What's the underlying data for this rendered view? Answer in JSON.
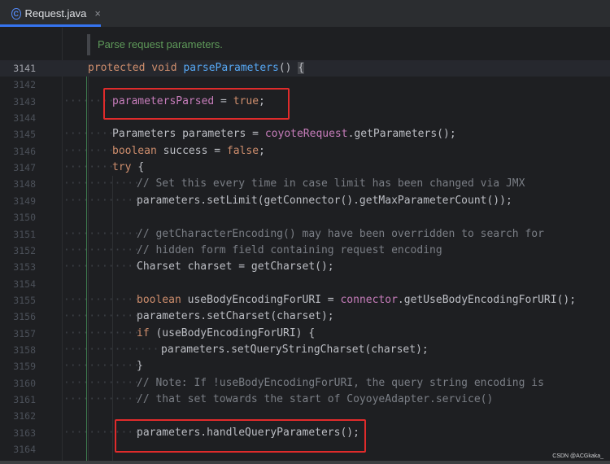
{
  "tab": {
    "icon_letter": "C",
    "label": "Request.java",
    "close": "×"
  },
  "doc_comment": "Parse request parameters.",
  "lines": [
    {
      "num": "3141",
      "html": "<span class=\"kw\">protected void </span><span class=\"fn\">parseParameters</span>() <span class=\"cur-brace\">{</span>"
    },
    {
      "num": "3142",
      "html": ""
    },
    {
      "num": "3143",
      "html": "<span class=\"fld\">parametersParsed</span> = <span class=\"kw\">true</span>;"
    },
    {
      "num": "3144",
      "html": ""
    },
    {
      "num": "3145",
      "html": "Parameters parameters = <span class=\"fld\">coyoteRequest</span>.getParameters();"
    },
    {
      "num": "3146",
      "html": "<span class=\"kw\">boolean </span>success = <span class=\"kw\">false</span>;"
    },
    {
      "num": "3147",
      "html": "<span class=\"kw\">try </span>{"
    },
    {
      "num": "3148",
      "html": "<span class=\"cm\">// Set this every time in case limit has been changed via JMX</span>"
    },
    {
      "num": "3149",
      "html": "parameters.setLimit(getConnector().getMaxParameterCount());"
    },
    {
      "num": "3150",
      "html": ""
    },
    {
      "num": "3151",
      "html": "<span class=\"cm\">// getCharacterEncoding() may have been overridden to search for</span>"
    },
    {
      "num": "3152",
      "html": "<span class=\"cm\">// hidden form field containing request encoding</span>"
    },
    {
      "num": "3153",
      "html": "Charset charset = getCharset();"
    },
    {
      "num": "3154",
      "html": ""
    },
    {
      "num": "3155",
      "html": "<span class=\"kw\">boolean </span>useBodyEncodingForURI = <span class=\"fld\">connector</span>.getUseBodyEncodingForURI();"
    },
    {
      "num": "3156",
      "html": "parameters.setCharset(charset);"
    },
    {
      "num": "3157",
      "html": "<span class=\"kw\">if </span>(useBodyEncodingForURI) {"
    },
    {
      "num": "3158",
      "html": "parameters.setQueryStringCharset(charset);"
    },
    {
      "num": "3159",
      "html": "}"
    },
    {
      "num": "3160",
      "html": "<span class=\"cm\">// Note: If !useBodyEncodingForURI, the query string encoding is</span>"
    },
    {
      "num": "3161",
      "html": "<span class=\"cm\">// that set towards the start of CoyoyeAdapter.service()</span>"
    },
    {
      "num": "3162",
      "html": ""
    },
    {
      "num": "3163",
      "html": "parameters.handleQueryParameters();"
    },
    {
      "num": "3164",
      "html": ""
    }
  ],
  "watermark": "CSDN @ACGkaka_",
  "colors": {
    "keyword": "#cf8e6d",
    "method": "#56a8f5",
    "field": "#c77dbb",
    "comment": "#7a7e85",
    "highlight_box": "#e02b2b"
  }
}
